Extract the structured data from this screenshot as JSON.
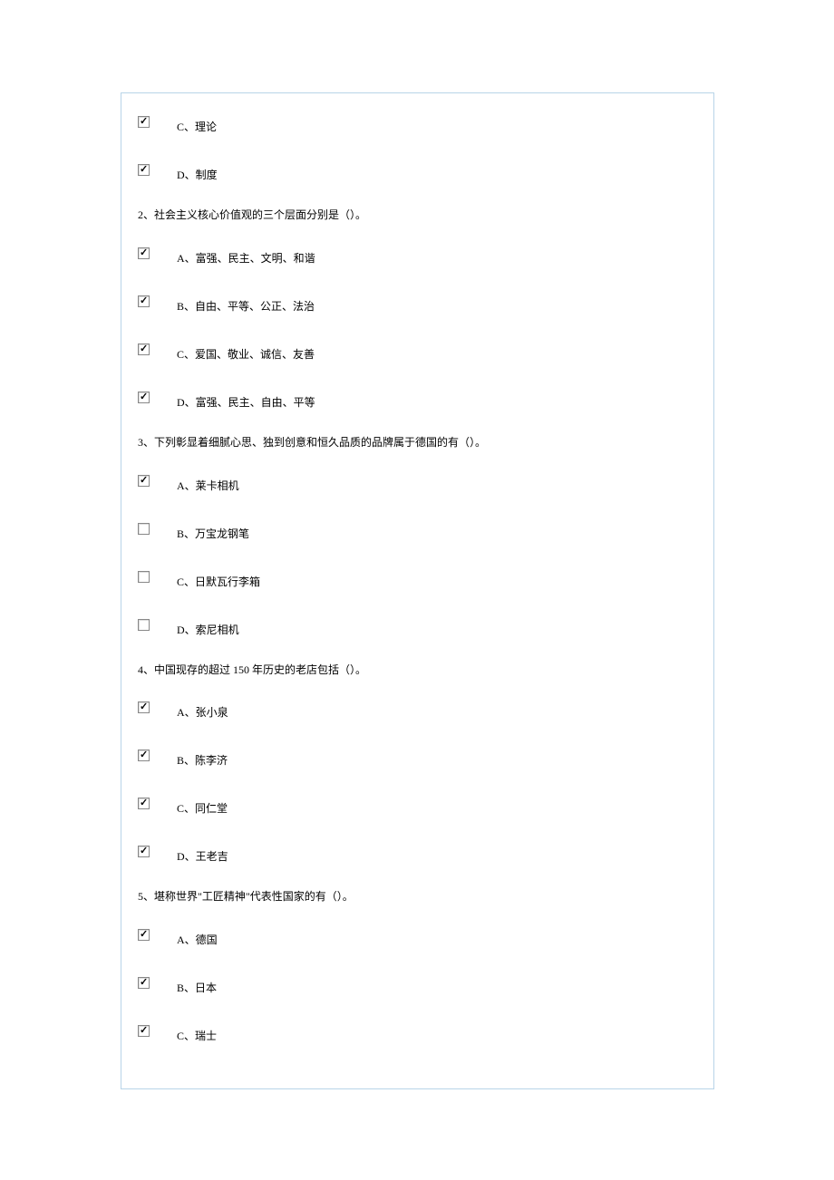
{
  "orphanOptions": [
    {
      "label": "C、理论",
      "checked": true
    },
    {
      "label": "D、制度",
      "checked": true
    }
  ],
  "questions": [
    {
      "number": "2",
      "text": "2、社会主义核心价值观的三个层面分别是（）。",
      "options": [
        {
          "label": "A、富强、民主、文明、和谐",
          "checked": true
        },
        {
          "label": "B、自由、平等、公正、法治",
          "checked": true
        },
        {
          "label": "C、爱国、敬业、诚信、友善",
          "checked": true
        },
        {
          "label": "D、富强、民主、自由、平等",
          "checked": true
        }
      ]
    },
    {
      "number": "3",
      "text": "3、下列彰显着细腻心思、独到创意和恒久品质的品牌属于德国的有（）。",
      "options": [
        {
          "label": "A、莱卡相机",
          "checked": true
        },
        {
          "label": "B、万宝龙钢笔",
          "checked": false
        },
        {
          "label": "C、日默瓦行李箱",
          "checked": false
        },
        {
          "label": "D、索尼相机",
          "checked": false
        }
      ]
    },
    {
      "number": "4",
      "text": "4、中国现存的超过 150 年历史的老店包括（）。",
      "options": [
        {
          "label": "A、张小泉",
          "checked": true
        },
        {
          "label": "B、陈李济",
          "checked": true
        },
        {
          "label": "C、同仁堂",
          "checked": true
        },
        {
          "label": "D、王老吉",
          "checked": true
        }
      ]
    },
    {
      "number": "5",
      "text": "5、堪称世界\"工匠精神\"代表性国家的有（）。",
      "options": [
        {
          "label": "A、德国",
          "checked": true
        },
        {
          "label": "B、日本",
          "checked": true
        },
        {
          "label": "C、瑞士",
          "checked": true
        }
      ]
    }
  ]
}
